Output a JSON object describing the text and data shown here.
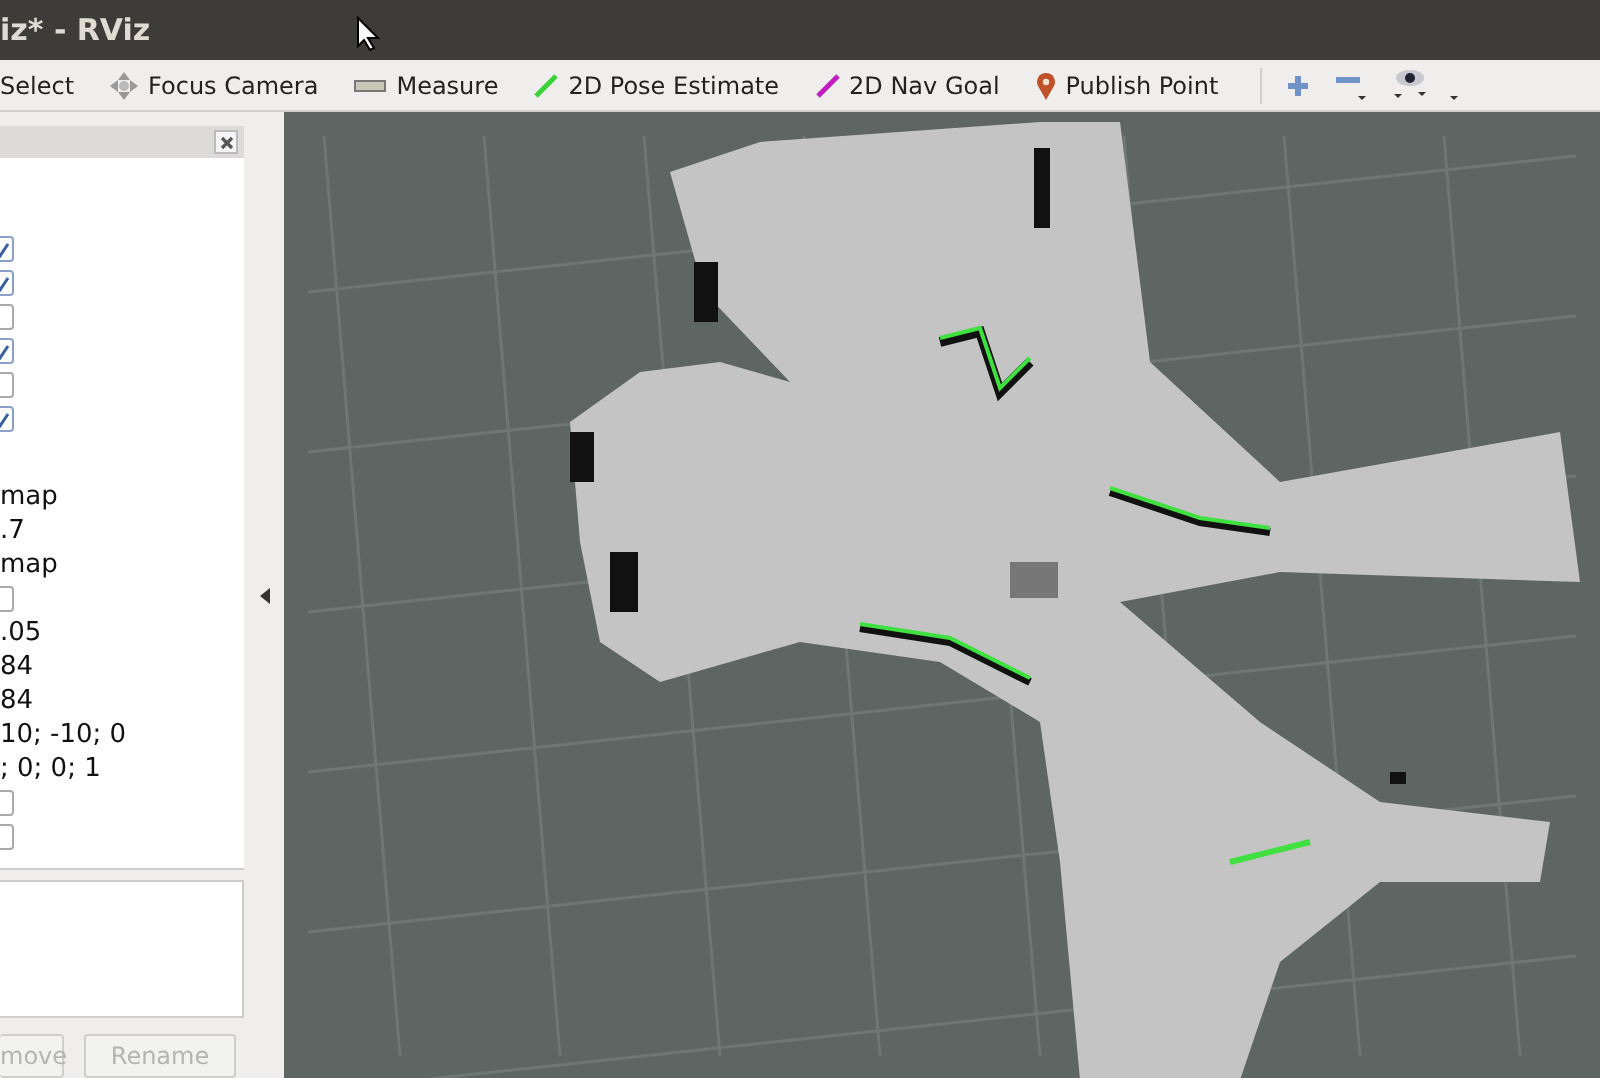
{
  "window": {
    "title": "iz* - RViz"
  },
  "toolbar": [
    {
      "label": "Select",
      "kind": "plain"
    },
    {
      "label": "Focus Camera",
      "kind": "focus"
    },
    {
      "label": "Measure",
      "kind": "measure"
    },
    {
      "label": "2D Pose Estimate",
      "kind": "pose"
    },
    {
      "label": "2D Nav Goal",
      "kind": "goal"
    },
    {
      "label": "Publish Point",
      "kind": "point"
    }
  ],
  "view_tools": [
    {
      "kind": "plus"
    },
    {
      "kind": "minus"
    },
    {
      "kind": "eye"
    }
  ],
  "panel": {
    "display_flags": [
      {
        "checked": true
      },
      {
        "checked": true
      },
      {
        "checked": false
      },
      {
        "checked": true
      },
      {
        "checked": false
      },
      {
        "checked": true
      }
    ],
    "properties": [
      {
        "kind": "text",
        "value": "map"
      },
      {
        "kind": "text",
        "value": ".7"
      },
      {
        "kind": "text",
        "value": "map"
      },
      {
        "kind": "checkbox",
        "checked": false
      },
      {
        "kind": "text",
        "value": ".05"
      },
      {
        "kind": "text",
        "value": "84"
      },
      {
        "kind": "text",
        "value": "84"
      },
      {
        "kind": "text",
        "value": "10; -10; 0"
      },
      {
        "kind": "text",
        "value": "; 0; 0; 1"
      },
      {
        "kind": "checkbox",
        "checked": false
      },
      {
        "kind": "checkbox",
        "checked": false
      }
    ],
    "buttons": [
      {
        "label": "move",
        "disabled": true
      },
      {
        "label": "Rename",
        "disabled": true
      }
    ]
  }
}
